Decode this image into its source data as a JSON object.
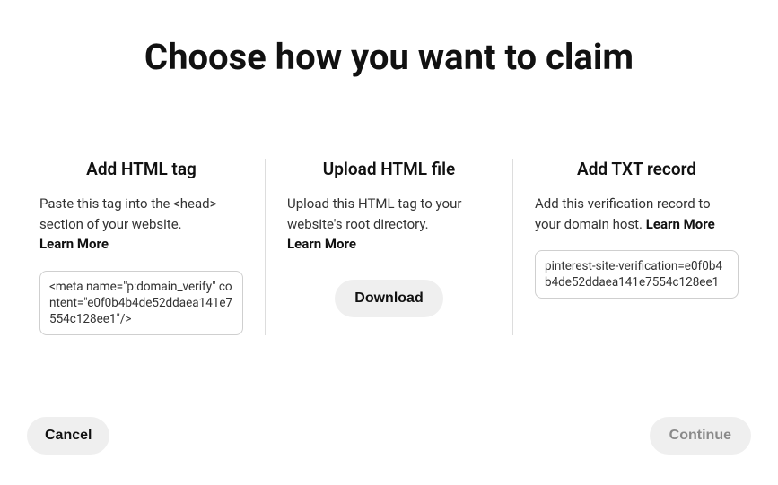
{
  "title": "Choose how you want to claim",
  "options": {
    "html_tag": {
      "title": "Add HTML tag",
      "desc": "Paste this tag into the <head> section of your website. ",
      "learn_more": "Learn More",
      "code": "<meta name=\"p:domain_verify\" content=\"e0f0b4b4de52ddaea141e7554c128ee1\"/>"
    },
    "html_file": {
      "title": "Upload HTML file",
      "desc": "Upload this HTML tag to your website's root directory. ",
      "learn_more": "Learn More",
      "download_label": "Download"
    },
    "txt_record": {
      "title": "Add TXT record",
      "desc": "Add this verification record to your domain host. ",
      "learn_more": "Learn More",
      "code": "pinterest-site-verification=e0f0b4b4de52ddaea141e7554c128ee1"
    }
  },
  "footer": {
    "cancel": "Cancel",
    "continue": "Continue"
  }
}
